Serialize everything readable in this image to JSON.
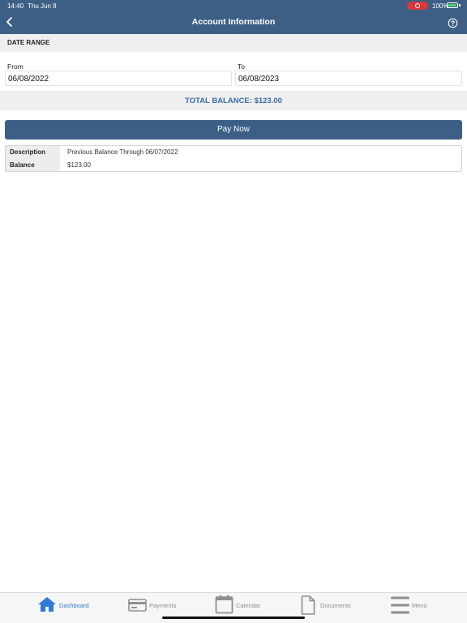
{
  "status_bar": {
    "time": "14:40",
    "date": "Thu Jun 8",
    "battery": "100%"
  },
  "header": {
    "title": "Account Information",
    "back_icon": "chevron-left-icon",
    "help_icon": "question-circle-icon"
  },
  "date_range": {
    "heading": "DATE RANGE",
    "from_label": "From",
    "from_value": "06/08/2022",
    "to_label": "To",
    "to_value": "06/08/2023"
  },
  "total_balance": "TOTAL BALANCE: $123.00",
  "pay_now_label": "Pay Now",
  "details": [
    {
      "key": "Description",
      "value": "Previous Balance Through 06/07/2022"
    },
    {
      "key": "Balance",
      "value": "$123.00"
    }
  ],
  "tabs": [
    {
      "label": "Dashboard",
      "icon": "home-icon",
      "active": true
    },
    {
      "label": "Payments",
      "icon": "credit-card-icon",
      "active": false
    },
    {
      "label": "Calendar",
      "icon": "calendar-icon",
      "active": false
    },
    {
      "label": "Documents",
      "icon": "document-icon",
      "active": false
    },
    {
      "label": "Menu",
      "icon": "menu-icon",
      "active": false
    }
  ],
  "colors": {
    "header": "#3d5f86",
    "accent": "#3a6da8",
    "tab_active": "#2f7bd6",
    "tab_inactive": "#8e8e8e"
  }
}
